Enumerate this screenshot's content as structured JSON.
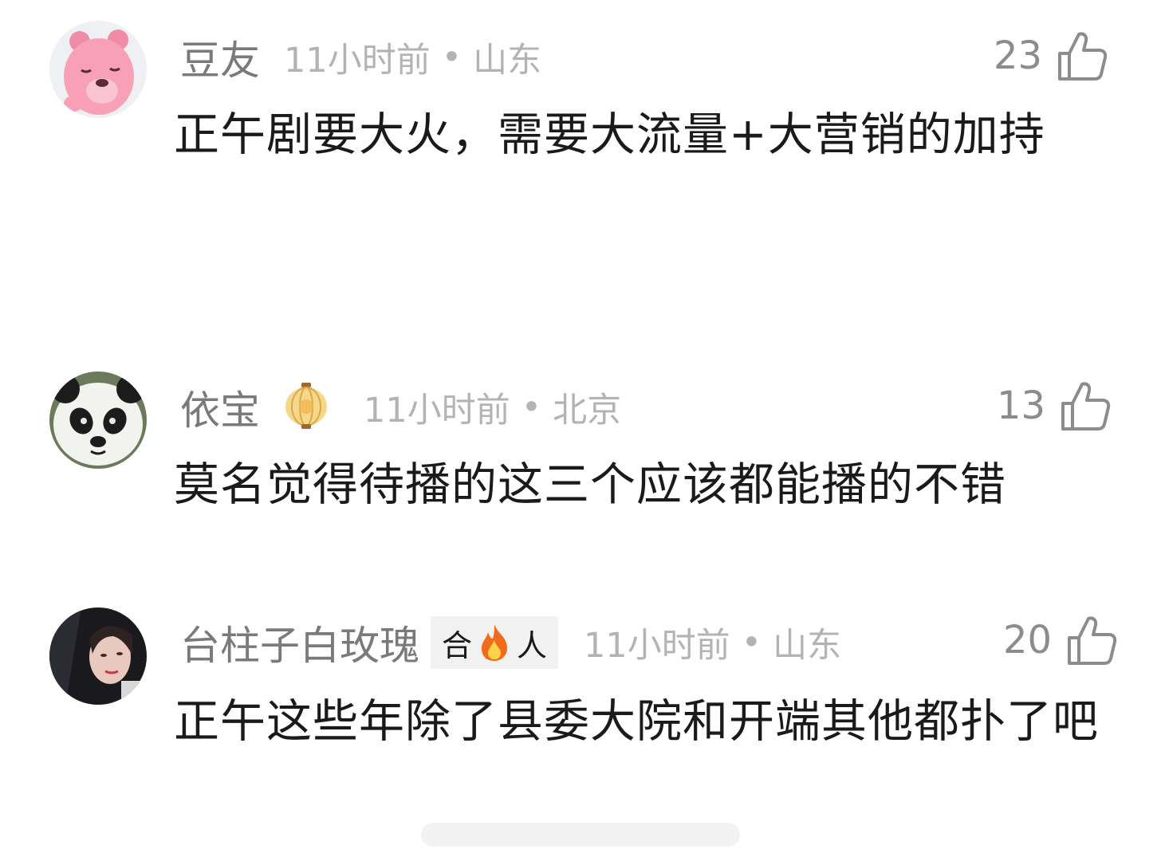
{
  "comments": [
    {
      "username": "豆友",
      "time": "11小时前",
      "separator": "•",
      "location": "山东",
      "likes": "23",
      "text": "正午剧要大火，需要大流量+大营销的加持",
      "avatar_icon": "pink-beaver-avatar"
    },
    {
      "username": "依宝",
      "time": "11小时前",
      "separator": "•",
      "location": "北京",
      "likes": "13",
      "text": "莫名觉得待播的这三个应该都能播的不错",
      "avatar_icon": "panda-avatar",
      "badge_icon": "lantern-icon"
    },
    {
      "username": "台柱子白玫瑰",
      "badge": {
        "left": "合",
        "right": "人"
      },
      "time": "11小时前",
      "separator": "•",
      "location": "山东",
      "likes": "20",
      "text": "正午这些年除了县委大院和开端其他都扑了吧",
      "avatar_icon": "woman-portrait-avatar"
    }
  ],
  "colors": {
    "username": "#7a7a7a",
    "meta": "#b3b3b3",
    "text": "#1a1a1a",
    "like": "#8c8c8c"
  }
}
